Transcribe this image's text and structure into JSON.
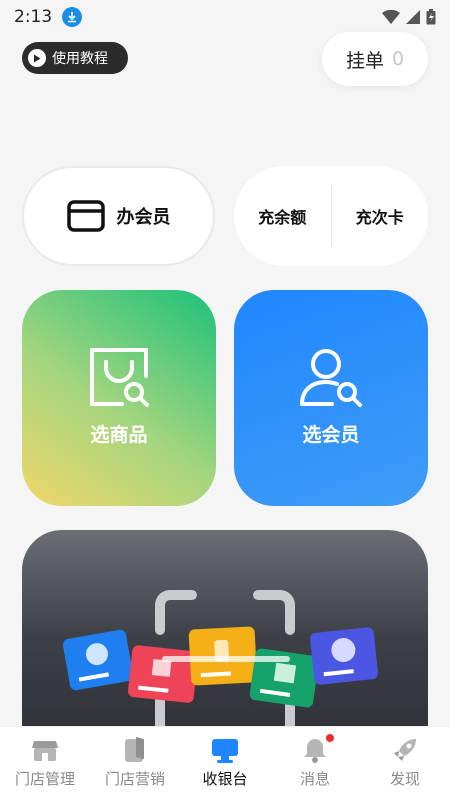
{
  "status": {
    "time": "2:13"
  },
  "tutorial": {
    "label": "使用教程"
  },
  "hang_order": {
    "label": "挂单",
    "count": "0"
  },
  "member_card": {
    "label": "办会员"
  },
  "recharge": {
    "balance_label": "充余额",
    "times_label": "充次卡"
  },
  "tiles": {
    "select_goods": "选商品",
    "select_member": "选会员"
  },
  "nav": {
    "items": [
      {
        "label": "门店管理",
        "icon": "store-icon"
      },
      {
        "label": "门店营销",
        "icon": "marketing-icon"
      },
      {
        "label": "收银台",
        "icon": "cashier-icon"
      },
      {
        "label": "消息",
        "icon": "bell-icon"
      },
      {
        "label": "发现",
        "icon": "rocket-icon"
      }
    ],
    "active": "收银台"
  },
  "colors": {
    "accent_blue": "#1f86ff",
    "green": "#1cc17a",
    "badge_red": "#ee2b2b"
  }
}
